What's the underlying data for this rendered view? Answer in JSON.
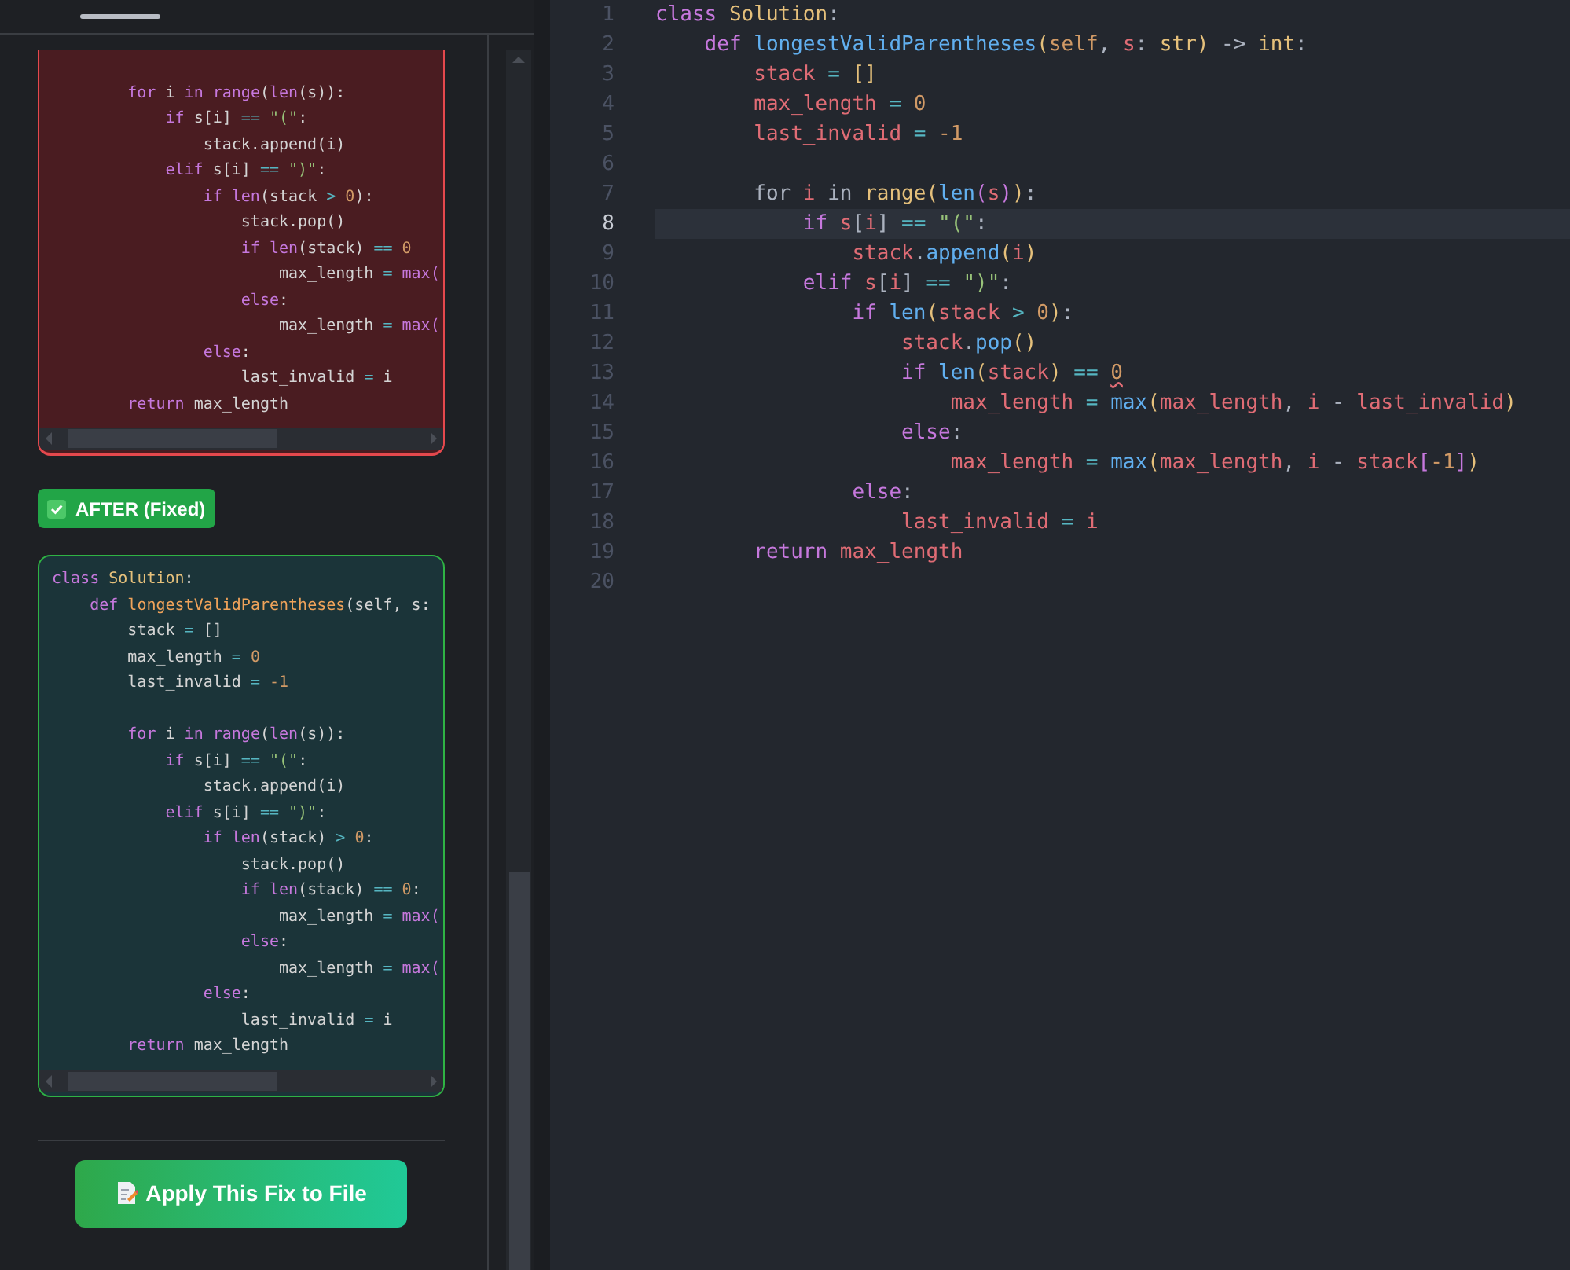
{
  "panels": [
    {
      "kind": "before",
      "lines": [
        {
          "kind": "blank"
        },
        {
          "kind": "code",
          "tokens": [
            {
              "kind": "keyword",
              "text": "        for"
            },
            {
              "kind": "plain",
              "text": " i "
            },
            {
              "kind": "keyword",
              "text": "in"
            },
            {
              "kind": "keyword",
              "text": " range"
            },
            {
              "kind": "plain",
              "text": "("
            },
            {
              "kind": "keyword",
              "text": "len"
            },
            {
              "kind": "plain",
              "text": "(s)):"
            }
          ]
        },
        {
          "kind": "code",
          "tokens": [
            {
              "kind": "keyword",
              "text": "            if"
            },
            {
              "kind": "plain",
              "text": " s[i] "
            },
            {
              "kind": "operator",
              "text": "=="
            },
            {
              "kind": "string",
              "text": " \"(\""
            },
            {
              "kind": "plain",
              "text": ":"
            }
          ]
        },
        {
          "kind": "code",
          "tokens": [
            {
              "kind": "plain",
              "text": "                stack.append(i)"
            }
          ]
        },
        {
          "kind": "code",
          "tokens": [
            {
              "kind": "keyword",
              "text": "            elif"
            },
            {
              "kind": "plain",
              "text": " s[i] "
            },
            {
              "kind": "operator",
              "text": "=="
            },
            {
              "kind": "string",
              "text": " \")\""
            },
            {
              "kind": "plain",
              "text": ":"
            }
          ]
        },
        {
          "kind": "code",
          "tokens": [
            {
              "kind": "keyword",
              "text": "                if"
            },
            {
              "kind": "keyword",
              "text": " len"
            },
            {
              "kind": "plain",
              "text": "(stack "
            },
            {
              "kind": "operator",
              "text": ">"
            },
            {
              "kind": "number",
              "text": " 0"
            },
            {
              "kind": "plain",
              "text": "):"
            }
          ]
        },
        {
          "kind": "code",
          "tokens": [
            {
              "kind": "plain",
              "text": "                    stack.pop()"
            }
          ]
        },
        {
          "kind": "code",
          "tokens": [
            {
              "kind": "keyword",
              "text": "                    if"
            },
            {
              "kind": "keyword",
              "text": " len"
            },
            {
              "kind": "plain",
              "text": "(stack) "
            },
            {
              "kind": "operator",
              "text": "=="
            },
            {
              "kind": "number",
              "text": " 0"
            }
          ]
        },
        {
          "kind": "code",
          "tokens": [
            {
              "kind": "plain",
              "text": "                        max_length "
            },
            {
              "kind": "operator",
              "text": "="
            },
            {
              "kind": "keyword",
              "text": " max("
            }
          ]
        },
        {
          "kind": "code",
          "tokens": [
            {
              "kind": "keyword",
              "text": "                    else"
            },
            {
              "kind": "plain",
              "text": ":"
            }
          ]
        },
        {
          "kind": "code",
          "tokens": [
            {
              "kind": "plain",
              "text": "                        max_length "
            },
            {
              "kind": "operator",
              "text": "="
            },
            {
              "kind": "keyword",
              "text": " max("
            }
          ]
        },
        {
          "kind": "code",
          "tokens": [
            {
              "kind": "keyword",
              "text": "                else"
            },
            {
              "kind": "plain",
              "text": ":"
            }
          ]
        },
        {
          "kind": "code",
          "tokens": [
            {
              "kind": "plain",
              "text": "                    last_invalid "
            },
            {
              "kind": "operator",
              "text": "="
            },
            {
              "kind": "plain",
              "text": " i"
            }
          ]
        },
        {
          "kind": "code",
          "tokens": [
            {
              "kind": "keyword",
              "text": "        return"
            },
            {
              "kind": "plain",
              "text": " max_length"
            }
          ]
        }
      ]
    },
    {
      "kind": "after",
      "badge": "AFTER (Fixed)",
      "lines": [
        {
          "kind": "code",
          "tokens": [
            {
              "kind": "keyword",
              "text": "class"
            },
            {
              "kind": "type",
              "text": " Solution"
            },
            {
              "kind": "plain",
              "text": ":"
            }
          ]
        },
        {
          "kind": "code",
          "tokens": [
            {
              "kind": "keyword",
              "text": "    def"
            },
            {
              "kind": "name",
              "text": " longestValidParentheses"
            },
            {
              "kind": "plain",
              "text": "(self, s:"
            }
          ]
        },
        {
          "kind": "code",
          "tokens": [
            {
              "kind": "plain",
              "text": "        stack "
            },
            {
              "kind": "operator",
              "text": "="
            },
            {
              "kind": "plain",
              "text": " []"
            }
          ]
        },
        {
          "kind": "code",
          "tokens": [
            {
              "kind": "plain",
              "text": "        max_length "
            },
            {
              "kind": "operator",
              "text": "="
            },
            {
              "kind": "number",
              "text": " 0"
            }
          ]
        },
        {
          "kind": "code",
          "tokens": [
            {
              "kind": "plain",
              "text": "        last_invalid "
            },
            {
              "kind": "operator",
              "text": "="
            },
            {
              "kind": "number",
              "text": " -1"
            }
          ]
        },
        {
          "kind": "blank"
        },
        {
          "kind": "code",
          "tokens": [
            {
              "kind": "keyword",
              "text": "        for"
            },
            {
              "kind": "plain",
              "text": " i "
            },
            {
              "kind": "keyword",
              "text": "in"
            },
            {
              "kind": "keyword",
              "text": " range"
            },
            {
              "kind": "plain",
              "text": "("
            },
            {
              "kind": "keyword",
              "text": "len"
            },
            {
              "kind": "plain",
              "text": "(s)):"
            }
          ]
        },
        {
          "kind": "code",
          "tokens": [
            {
              "kind": "keyword",
              "text": "            if"
            },
            {
              "kind": "plain",
              "text": " s[i] "
            },
            {
              "kind": "operator",
              "text": "=="
            },
            {
              "kind": "string",
              "text": " \"(\""
            },
            {
              "kind": "plain",
              "text": ":"
            }
          ]
        },
        {
          "kind": "code",
          "tokens": [
            {
              "kind": "plain",
              "text": "                stack.append(i)"
            }
          ]
        },
        {
          "kind": "code",
          "tokens": [
            {
              "kind": "keyword",
              "text": "            elif"
            },
            {
              "kind": "plain",
              "text": " s[i] "
            },
            {
              "kind": "operator",
              "text": "=="
            },
            {
              "kind": "string",
              "text": " \")\""
            },
            {
              "kind": "plain",
              "text": ":"
            }
          ]
        },
        {
          "kind": "code",
          "tokens": [
            {
              "kind": "keyword",
              "text": "                if"
            },
            {
              "kind": "keyword",
              "text": " len"
            },
            {
              "kind": "plain",
              "text": "(stack) "
            },
            {
              "kind": "operator",
              "text": ">"
            },
            {
              "kind": "number",
              "text": " 0"
            },
            {
              "kind": "plain",
              "text": ":"
            }
          ]
        },
        {
          "kind": "code",
          "tokens": [
            {
              "kind": "plain",
              "text": "                    stack.pop()"
            }
          ]
        },
        {
          "kind": "code",
          "tokens": [
            {
              "kind": "keyword",
              "text": "                    if"
            },
            {
              "kind": "keyword",
              "text": " len"
            },
            {
              "kind": "plain",
              "text": "(stack) "
            },
            {
              "kind": "operator",
              "text": "=="
            },
            {
              "kind": "number",
              "text": " 0"
            },
            {
              "kind": "plain",
              "text": ":"
            }
          ]
        },
        {
          "kind": "code",
          "tokens": [
            {
              "kind": "plain",
              "text": "                        max_length "
            },
            {
              "kind": "operator",
              "text": "="
            },
            {
              "kind": "keyword",
              "text": " max("
            }
          ]
        },
        {
          "kind": "code",
          "tokens": [
            {
              "kind": "keyword",
              "text": "                    else"
            },
            {
              "kind": "plain",
              "text": ":"
            }
          ]
        },
        {
          "kind": "code",
          "tokens": [
            {
              "kind": "plain",
              "text": "                        max_length "
            },
            {
              "kind": "operator",
              "text": "="
            },
            {
              "kind": "keyword",
              "text": " max("
            }
          ]
        },
        {
          "kind": "code",
          "tokens": [
            {
              "kind": "keyword",
              "text": "                else"
            },
            {
              "kind": "plain",
              "text": ":"
            }
          ]
        },
        {
          "kind": "code",
          "tokens": [
            {
              "kind": "plain",
              "text": "                    last_invalid "
            },
            {
              "kind": "operator",
              "text": "="
            },
            {
              "kind": "plain",
              "text": " i"
            }
          ]
        },
        {
          "kind": "code",
          "tokens": [
            {
              "kind": "keyword",
              "text": "        return"
            },
            {
              "kind": "plain",
              "text": " max_length"
            }
          ]
        }
      ]
    }
  ],
  "apply_button": "Apply This Fix to File",
  "editor": {
    "lines": [
      {
        "number": "1",
        "selected": false,
        "kind": "code",
        "tokens": [
          {
            "kind": "keyword",
            "text": "class"
          },
          {
            "kind": "type",
            "text": " Solution"
          },
          {
            "kind": "plain",
            "text": ":"
          }
        ]
      },
      {
        "number": "2",
        "selected": false,
        "kind": "code",
        "tokens": [
          {
            "kind": "keyword",
            "text": "    def"
          },
          {
            "kind": "func",
            "text": " longestValidParentheses"
          },
          {
            "kind": "bracket",
            "text": "("
          },
          {
            "kind": "number",
            "text": "self"
          },
          {
            "kind": "plain",
            "text": ", "
          },
          {
            "kind": "variable",
            "text": "s"
          },
          {
            "kind": "plain",
            "text": ": "
          },
          {
            "kind": "type",
            "text": "str"
          },
          {
            "kind": "bracket",
            "text": ")"
          },
          {
            "kind": "plain",
            "text": " -> "
          },
          {
            "kind": "type",
            "text": "int"
          },
          {
            "kind": "plain",
            "text": ":"
          }
        ]
      },
      {
        "number": "3",
        "selected": false,
        "kind": "code",
        "tokens": [
          {
            "kind": "variable",
            "text": "        stack"
          },
          {
            "kind": "operator",
            "text": " = "
          },
          {
            "kind": "bracket",
            "text": "[]"
          }
        ]
      },
      {
        "number": "4",
        "selected": false,
        "kind": "code",
        "tokens": [
          {
            "kind": "variable",
            "text": "        max_length"
          },
          {
            "kind": "operator",
            "text": " = "
          },
          {
            "kind": "number",
            "text": "0"
          }
        ]
      },
      {
        "number": "5",
        "selected": false,
        "kind": "code",
        "tokens": [
          {
            "kind": "variable",
            "text": "        last_invalid"
          },
          {
            "kind": "operator",
            "text": " = "
          },
          {
            "kind": "number",
            "text": "-1"
          }
        ]
      },
      {
        "number": "6",
        "selected": false,
        "kind": "blank"
      },
      {
        "number": "7",
        "selected": false,
        "kind": "code",
        "tokens": [
          {
            "kind": "plain",
            "text": "        for "
          },
          {
            "kind": "variable",
            "text": "i"
          },
          {
            "kind": "plain",
            "text": " in "
          },
          {
            "kind": "type",
            "text": "range"
          },
          {
            "kind": "bracket",
            "text": "("
          },
          {
            "kind": "func",
            "text": "len"
          },
          {
            "kind": "keyword",
            "text": "("
          },
          {
            "kind": "variable",
            "text": "s"
          },
          {
            "kind": "keyword",
            "text": ")"
          },
          {
            "kind": "bracket",
            "text": ")"
          },
          {
            "kind": "plain",
            "text": ":"
          }
        ]
      },
      {
        "number": "8",
        "selected": true,
        "kind": "code",
        "tokens": [
          {
            "kind": "keyword",
            "text": "            if"
          },
          {
            "kind": "variable",
            "text": " s"
          },
          {
            "kind": "plain",
            "text": "["
          },
          {
            "kind": "variable",
            "text": "i"
          },
          {
            "kind": "plain",
            "text": "]"
          },
          {
            "kind": "operator",
            "text": " == "
          },
          {
            "kind": "string",
            "text": "\"(\""
          },
          {
            "kind": "plain",
            "text": ":"
          }
        ]
      },
      {
        "number": "9",
        "selected": false,
        "kind": "code",
        "tokens": [
          {
            "kind": "variable",
            "text": "                stack"
          },
          {
            "kind": "plain",
            "text": "."
          },
          {
            "kind": "func",
            "text": "append"
          },
          {
            "kind": "bracket",
            "text": "("
          },
          {
            "kind": "variable",
            "text": "i"
          },
          {
            "kind": "bracket",
            "text": ")"
          }
        ]
      },
      {
        "number": "10",
        "selected": false,
        "kind": "code",
        "tokens": [
          {
            "kind": "keyword",
            "text": "            elif"
          },
          {
            "kind": "variable",
            "text": " s"
          },
          {
            "kind": "plain",
            "text": "["
          },
          {
            "kind": "variable",
            "text": "i"
          },
          {
            "kind": "plain",
            "text": "]"
          },
          {
            "kind": "operator",
            "text": " == "
          },
          {
            "kind": "string",
            "text": "\")\""
          },
          {
            "kind": "plain",
            "text": ":"
          }
        ]
      },
      {
        "number": "11",
        "selected": false,
        "kind": "code",
        "tokens": [
          {
            "kind": "keyword",
            "text": "                if"
          },
          {
            "kind": "func",
            "text": " len"
          },
          {
            "kind": "bracket",
            "text": "("
          },
          {
            "kind": "variable",
            "text": "stack"
          },
          {
            "kind": "operator",
            "text": " > "
          },
          {
            "kind": "number",
            "text": "0"
          },
          {
            "kind": "bracket",
            "text": ")"
          },
          {
            "kind": "plain",
            "text": ":"
          }
        ]
      },
      {
        "number": "12",
        "selected": false,
        "kind": "code",
        "tokens": [
          {
            "kind": "variable",
            "text": "                    stack"
          },
          {
            "kind": "plain",
            "text": "."
          },
          {
            "kind": "func",
            "text": "pop"
          },
          {
            "kind": "bracket",
            "text": "()"
          }
        ]
      },
      {
        "number": "13",
        "selected": false,
        "kind": "code",
        "tokens": [
          {
            "kind": "keyword",
            "text": "                    if"
          },
          {
            "kind": "func",
            "text": " len"
          },
          {
            "kind": "bracket",
            "text": "("
          },
          {
            "kind": "variable",
            "text": "stack"
          },
          {
            "kind": "bracket",
            "text": ")"
          },
          {
            "kind": "operator",
            "text": " == "
          },
          {
            "kind": "number",
            "text": "0",
            "error": true
          }
        ]
      },
      {
        "number": "14",
        "selected": false,
        "kind": "code",
        "tokens": [
          {
            "kind": "variable",
            "text": "                        max_length"
          },
          {
            "kind": "operator",
            "text": " = "
          },
          {
            "kind": "func",
            "text": "max"
          },
          {
            "kind": "bracket",
            "text": "("
          },
          {
            "kind": "variable",
            "text": "max_length"
          },
          {
            "kind": "plain",
            "text": ", "
          },
          {
            "kind": "variable",
            "text": "i"
          },
          {
            "kind": "plain",
            "text": " - "
          },
          {
            "kind": "variable",
            "text": "last_invalid"
          },
          {
            "kind": "bracket",
            "text": ")"
          }
        ]
      },
      {
        "number": "15",
        "selected": false,
        "kind": "code",
        "tokens": [
          {
            "kind": "keyword",
            "text": "                    else"
          },
          {
            "kind": "plain",
            "text": ":"
          }
        ]
      },
      {
        "number": "16",
        "selected": false,
        "kind": "code",
        "tokens": [
          {
            "kind": "variable",
            "text": "                        max_length"
          },
          {
            "kind": "operator",
            "text": " = "
          },
          {
            "kind": "func",
            "text": "max"
          },
          {
            "kind": "bracket",
            "text": "("
          },
          {
            "kind": "variable",
            "text": "max_length"
          },
          {
            "kind": "plain",
            "text": ", "
          },
          {
            "kind": "variable",
            "text": "i"
          },
          {
            "kind": "plain",
            "text": " - "
          },
          {
            "kind": "variable",
            "text": "stack"
          },
          {
            "kind": "keyword",
            "text": "["
          },
          {
            "kind": "number",
            "text": "-1"
          },
          {
            "kind": "keyword",
            "text": "]"
          },
          {
            "kind": "bracket",
            "text": ")"
          }
        ]
      },
      {
        "number": "17",
        "selected": false,
        "kind": "code",
        "tokens": [
          {
            "kind": "keyword",
            "text": "                else"
          },
          {
            "kind": "plain",
            "text": ":"
          }
        ]
      },
      {
        "number": "18",
        "selected": false,
        "kind": "code",
        "tokens": [
          {
            "kind": "variable",
            "text": "                    last_invalid"
          },
          {
            "kind": "operator",
            "text": " = "
          },
          {
            "kind": "variable",
            "text": "i"
          }
        ]
      },
      {
        "number": "19",
        "selected": false,
        "kind": "code",
        "tokens": [
          {
            "kind": "keyword",
            "text": "        return"
          },
          {
            "kind": "variable",
            "text": " max_length"
          }
        ]
      },
      {
        "number": "20",
        "selected": false,
        "kind": "blank"
      }
    ]
  }
}
